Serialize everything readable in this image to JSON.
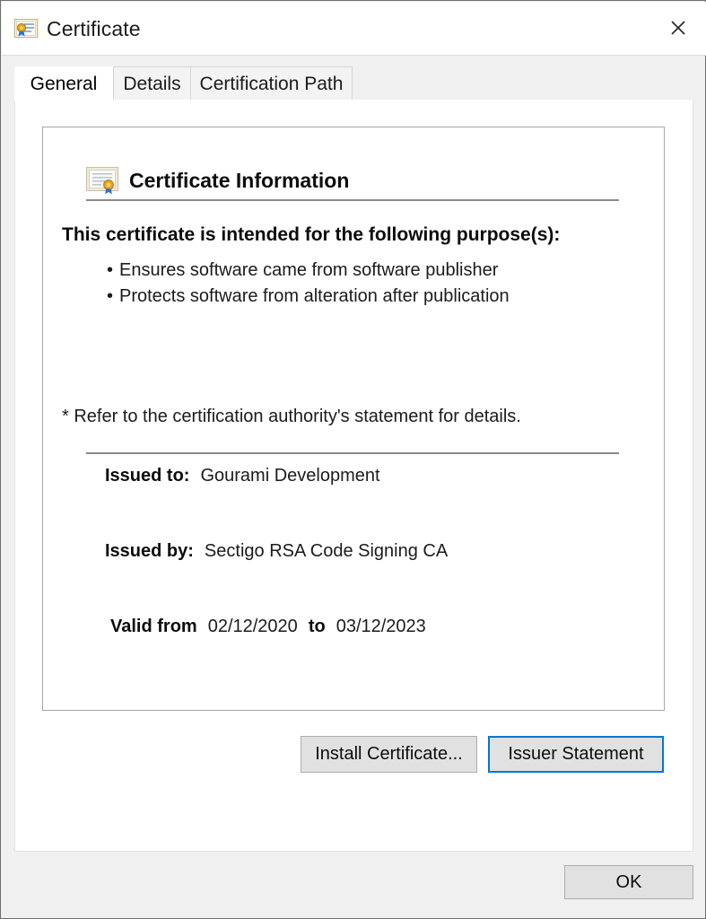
{
  "window": {
    "title": "Certificate",
    "title_icon": "certificate-icon",
    "close_label": "✕"
  },
  "tabs": [
    {
      "label": "General",
      "active": true
    },
    {
      "label": "Details",
      "active": false
    },
    {
      "label": "Certification Path",
      "active": false
    }
  ],
  "general": {
    "header_icon": "certificate-icon",
    "header_title": "Certificate Information",
    "purpose_title": "This certificate is intended for the following purpose(s):",
    "purposes": [
      "Ensures software came from software publisher",
      "Protects software from alteration after publication"
    ],
    "refer_note": "* Refer to the certification authority's statement for details.",
    "fields": {
      "issued_to_label": "Issued to:",
      "issued_to_value": "Gourami Development",
      "issued_by_label": "Issued by:",
      "issued_by_value": "Sectigo RSA Code Signing CA",
      "valid_from_label": "Valid from",
      "valid_from_value": "02/12/2020",
      "valid_to_word": "to",
      "valid_to_value": "03/12/2023"
    }
  },
  "buttons": {
    "install_certificate": "Install Certificate...",
    "issuer_statement": "Issuer Statement",
    "ok": "OK"
  },
  "colors": {
    "focus_blue": "#0078d7",
    "window_border": "#6e6e6e",
    "panel_border": "#a6a6a6",
    "rule_gray": "#8a8a8a",
    "button_face": "#e1e1e1",
    "dialog_face": "#f0f0f0"
  }
}
